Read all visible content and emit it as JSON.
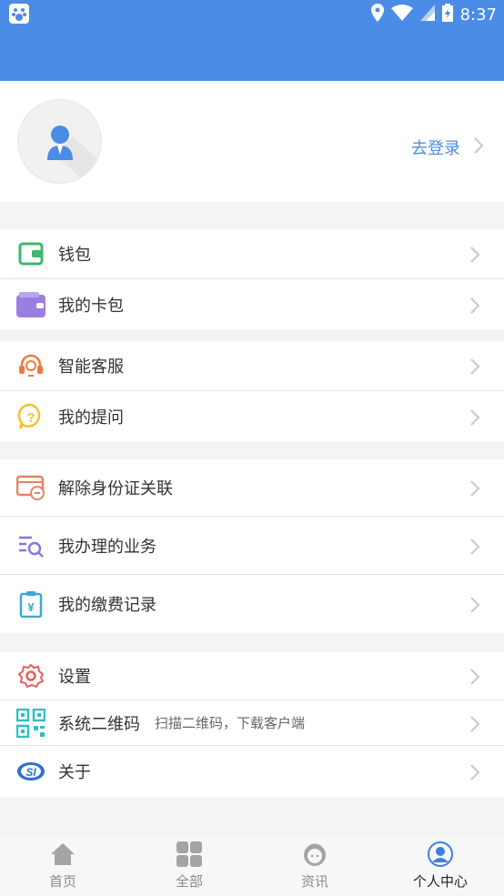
{
  "status_bar": {
    "time": "8:37"
  },
  "profile": {
    "login_label": "去登录"
  },
  "groups": [
    {
      "items": [
        {
          "label": "钱包",
          "icon": "wallet-icon"
        },
        {
          "label": "我的卡包",
          "icon": "card-bag-icon"
        }
      ]
    },
    {
      "items": [
        {
          "label": "智能客服",
          "icon": "headset-icon"
        },
        {
          "label": "我的提问",
          "icon": "question-icon"
        }
      ]
    },
    {
      "items": [
        {
          "label": "解除身份证关联",
          "icon": "id-card-icon"
        },
        {
          "label": "我办理的业务",
          "icon": "search-list-icon"
        },
        {
          "label": "我的缴费记录",
          "icon": "payment-record-icon"
        }
      ]
    },
    {
      "items": [
        {
          "label": "设置",
          "icon": "gear-icon"
        },
        {
          "label": "系统二维码",
          "sublabel": "扫描二维码，下载客户端",
          "icon": "qr-code-icon"
        },
        {
          "label": "关于",
          "icon": "about-logo-icon"
        }
      ]
    }
  ],
  "tabbar": [
    {
      "label": "首页",
      "icon": "home-icon"
    },
    {
      "label": "全部",
      "icon": "grid-icon"
    },
    {
      "label": "资讯",
      "icon": "news-icon"
    },
    {
      "label": "个人中心",
      "icon": "person-icon",
      "active": true
    }
  ],
  "colors": {
    "primary": "#4b8ce6",
    "background": "#f4f4f4"
  }
}
